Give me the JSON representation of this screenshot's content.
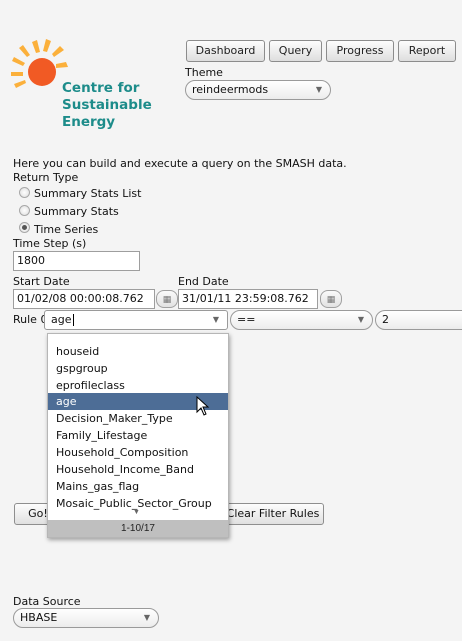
{
  "logo": {
    "line1": "Centre for",
    "line2": "Sustainable",
    "line3": "Energy"
  },
  "nav": {
    "dashboard": "Dashboard",
    "query": "Query",
    "progress": "Progress",
    "report": "Report"
  },
  "theme": {
    "label": "Theme",
    "value": "reindeermods"
  },
  "intro": "Here you can build and execute a query on the SMASH data.",
  "return_type": {
    "label": "Return Type",
    "options": [
      "Summary Stats List",
      "Summary Stats",
      "Time Series"
    ],
    "selected": "Time Series"
  },
  "time_step": {
    "label": "Time Step (s)",
    "value": "1800"
  },
  "start_date": {
    "label": "Start Date",
    "value": "01/02/08 00:00:08.762"
  },
  "end_date": {
    "label": "End Date",
    "value": "31/01/11 23:59:08.762"
  },
  "rule": {
    "label": "Rule 0",
    "field_value": "age",
    "operator": "==",
    "value": "2"
  },
  "dropdown": {
    "items": [
      "houseid",
      "gspgroup",
      "eprofileclass",
      "age",
      "Decision_Maker_Type",
      "Family_Lifestage",
      "Household_Composition",
      "Household_Income_Band",
      "Mains_gas_flag",
      "Mosaic_Public_Sector_Group"
    ],
    "highlighted": "age",
    "pager": "1-10/17"
  },
  "buttons": {
    "go": "Go!",
    "clear": "Clear Filter Rules"
  },
  "data_source": {
    "label": "Data Source",
    "value": "HBASE"
  },
  "colors": {
    "logo_text": "#1d8c8a",
    "sun_orange": "#f15a24",
    "sun_yellow": "#fbb03b",
    "selection": "#4d6d96"
  }
}
